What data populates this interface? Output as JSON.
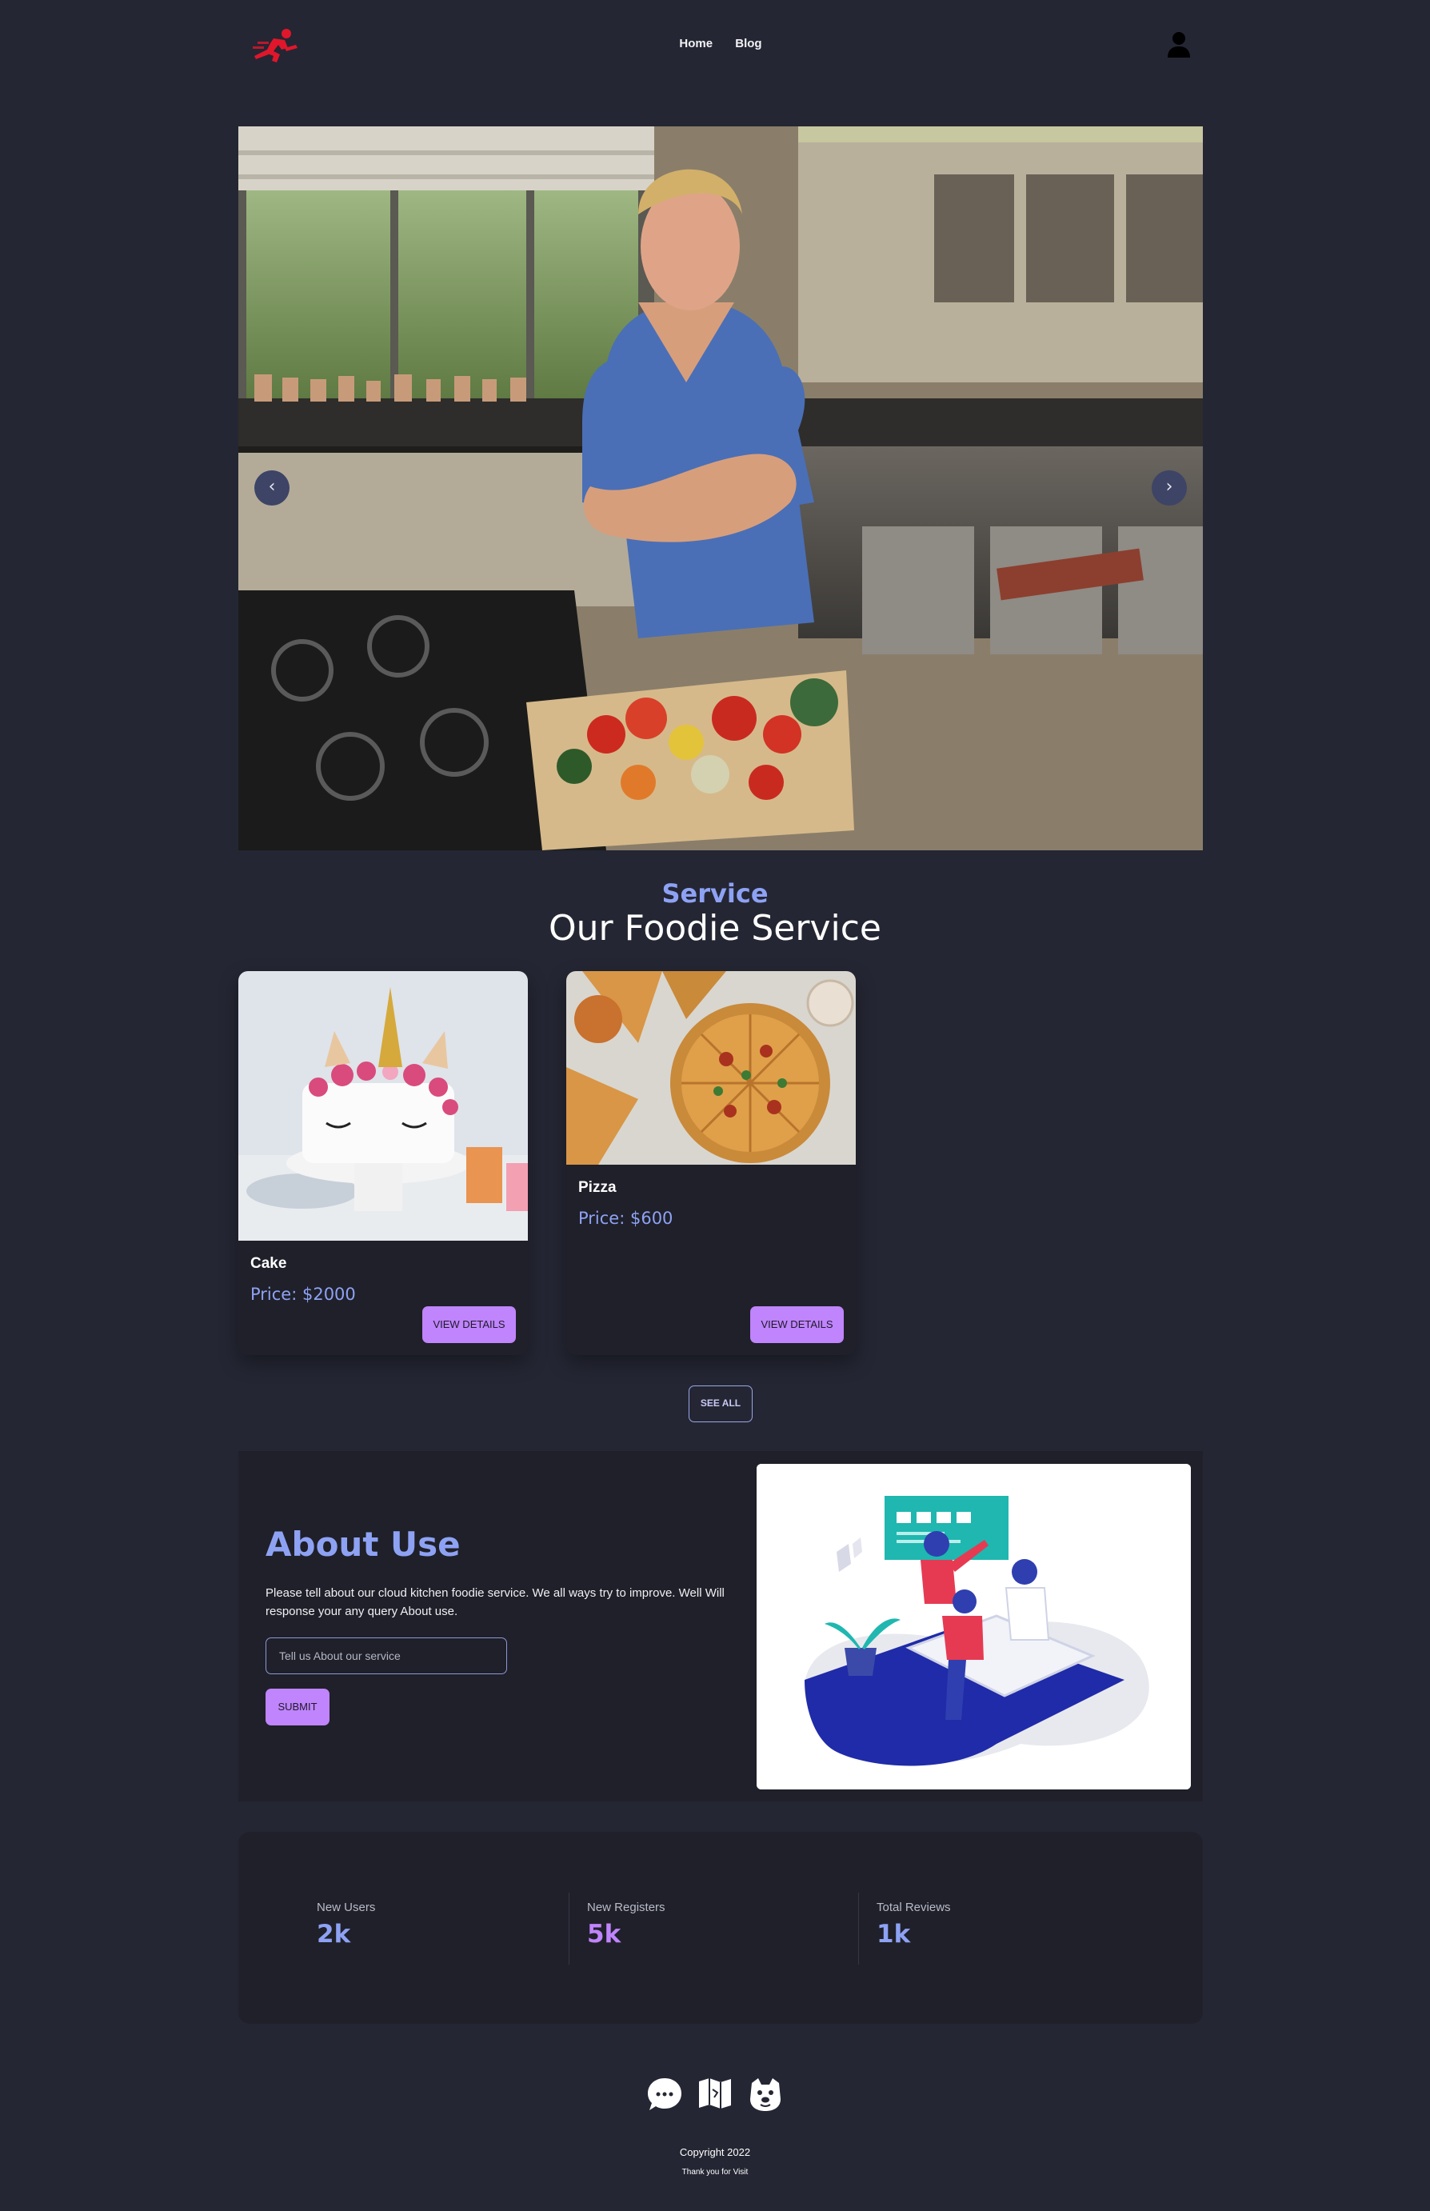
{
  "nav": {
    "logo_icon": "running-delivery-man-icon",
    "links": [
      "Home",
      "Blog"
    ],
    "user_icon": "user-icon"
  },
  "hero": {
    "image": "chef-in-kitchen-photo",
    "prev_icon": "‹",
    "next_icon": "›"
  },
  "service": {
    "kicker": "Service",
    "title": "Our Foodie Service",
    "cards": [
      {
        "name": "Cake",
        "price": "Price: $2000",
        "button": "VIEW DETAILS",
        "image": "unicorn-cake-photo"
      },
      {
        "name": "Pizza",
        "price": "Price: $600",
        "button": "VIEW DETAILS",
        "image": "pizza-photo"
      }
    ],
    "see_all": "SEE ALL"
  },
  "about": {
    "title": "About Use",
    "text": "Please tell about our cloud kitchen foodie service. We all ways try to improve. Well Will response your any query About use.",
    "input_placeholder": "Tell us About our service",
    "submit": "SUBMIT",
    "illustration": "team-collaboration-illustration"
  },
  "stats": [
    {
      "label": "New Users",
      "value": "2k",
      "color": "#8ea2f4"
    },
    {
      "label": "New Registers",
      "value": "5k",
      "color": "#c084fc"
    },
    {
      "label": "Total Reviews",
      "value": "1k",
      "color": "#8ea2f4"
    }
  ],
  "footer": {
    "social_icons": [
      "chat-bubble-icon",
      "map-icon",
      "dog-face-icon"
    ],
    "copyright": "Copyright 2022",
    "thanks": "Thank you for Visit"
  },
  "colors": {
    "background": "#242633",
    "panel": "#1f2029",
    "accent_blue": "#8ea2f4",
    "accent_purple": "#c084fc"
  }
}
